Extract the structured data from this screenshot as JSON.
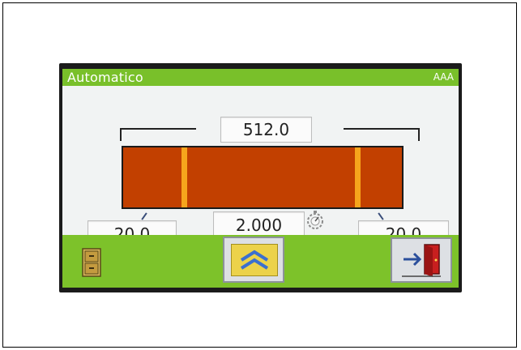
{
  "header": {
    "title": "Automatico",
    "code": "AAA"
  },
  "measurements": {
    "length": "512.0",
    "left_angle": "20.0",
    "right_angle": "20.0",
    "speed": "2.000"
  },
  "colors": {
    "green": "#79c02a",
    "piece": "#c24000",
    "marker": "#f6a51c",
    "up_button": "#ecd24a"
  },
  "icons": {
    "archive": "cabinet-icon",
    "up": "double-chevron-up-icon",
    "exit": "exit-door-icon",
    "speed": "dial-icon"
  }
}
